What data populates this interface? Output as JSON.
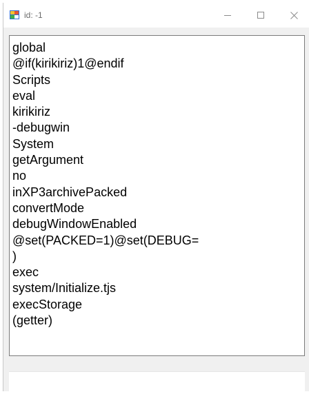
{
  "window": {
    "title": "id: -1",
    "icon": "application-icon"
  },
  "titlebar_buttons": {
    "minimize_icon": "minimize-icon",
    "maximize_icon": "maximize-icon",
    "close_icon": "close-icon"
  },
  "list": {
    "items": [
      "global",
      "@if(kirikiriz)1@endif",
      "Scripts",
      "eval",
      "kirikiriz",
      "-debugwin",
      "System",
      "getArgument",
      "no",
      "inXP3archivePacked",
      "convertMode",
      "debugWindowEnabled",
      "@set(PACKED=1)@set(DEBUG=",
      ")",
      "exec",
      "system/Initialize.tjs",
      "execStorage",
      "(getter)"
    ]
  },
  "lower_panel": {
    "text": ""
  }
}
